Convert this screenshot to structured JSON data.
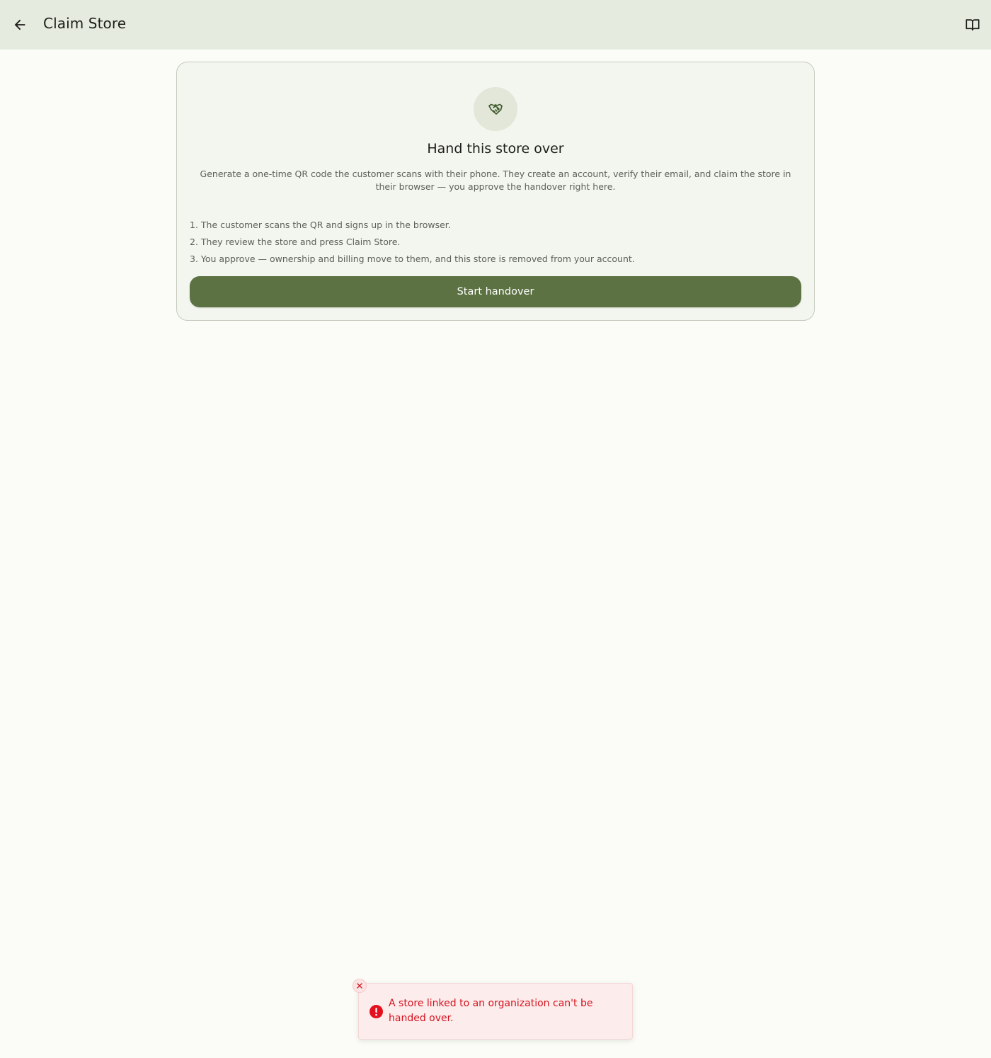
{
  "header": {
    "title": "Claim Store",
    "back_icon": "arrow-left-icon",
    "docs_icon": "open-book-icon"
  },
  "card": {
    "icon": "handshake-icon",
    "title": "Hand this store over",
    "description": "Generate a one-time QR code the customer scans with their phone. They create an account, verify their email, and claim the store in their browser — you approve the handover right here.",
    "steps": [
      "1. The customer scans the QR and signs up in the browser.",
      "2. They review the store and press Claim Store.",
      "3. You approve — ownership and billing move to them, and this store is removed from your account."
    ],
    "button_label": "Start handover"
  },
  "toast": {
    "type": "error",
    "message": "A store linked to an organization can't be handed over.",
    "close_icon": "close-icon",
    "status_icon": "error-circle-icon"
  },
  "colors": {
    "accent": "#5c7242",
    "header_bg": "#e6ebdf",
    "page_bg": "#fbfcf7",
    "error": "#d3121d"
  }
}
